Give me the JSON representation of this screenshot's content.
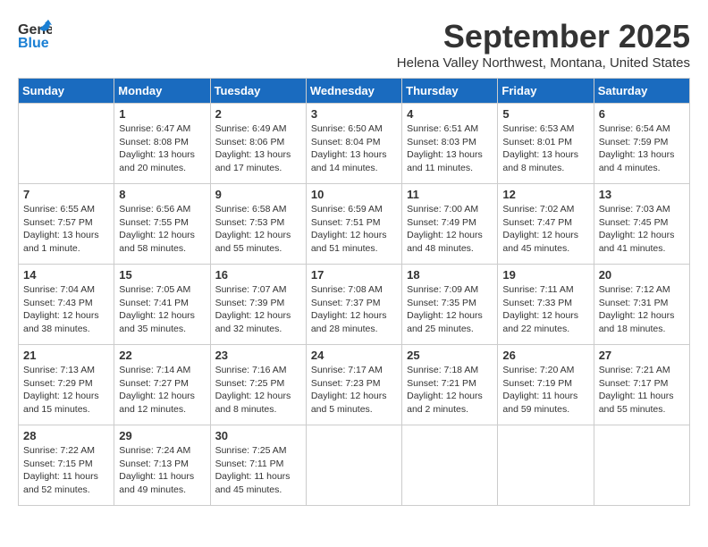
{
  "header": {
    "logo_general": "General",
    "logo_blue": "Blue",
    "title": "September 2025",
    "subtitle": "Helena Valley Northwest, Montana, United States"
  },
  "days_of_week": [
    "Sunday",
    "Monday",
    "Tuesday",
    "Wednesday",
    "Thursday",
    "Friday",
    "Saturday"
  ],
  "weeks": [
    [
      {
        "day": "",
        "content": ""
      },
      {
        "day": "1",
        "content": "Sunrise: 6:47 AM\nSunset: 8:08 PM\nDaylight: 13 hours\nand 20 minutes."
      },
      {
        "day": "2",
        "content": "Sunrise: 6:49 AM\nSunset: 8:06 PM\nDaylight: 13 hours\nand 17 minutes."
      },
      {
        "day": "3",
        "content": "Sunrise: 6:50 AM\nSunset: 8:04 PM\nDaylight: 13 hours\nand 14 minutes."
      },
      {
        "day": "4",
        "content": "Sunrise: 6:51 AM\nSunset: 8:03 PM\nDaylight: 13 hours\nand 11 minutes."
      },
      {
        "day": "5",
        "content": "Sunrise: 6:53 AM\nSunset: 8:01 PM\nDaylight: 13 hours\nand 8 minutes."
      },
      {
        "day": "6",
        "content": "Sunrise: 6:54 AM\nSunset: 7:59 PM\nDaylight: 13 hours\nand 4 minutes."
      }
    ],
    [
      {
        "day": "7",
        "content": "Sunrise: 6:55 AM\nSunset: 7:57 PM\nDaylight: 13 hours\nand 1 minute."
      },
      {
        "day": "8",
        "content": "Sunrise: 6:56 AM\nSunset: 7:55 PM\nDaylight: 12 hours\nand 58 minutes."
      },
      {
        "day": "9",
        "content": "Sunrise: 6:58 AM\nSunset: 7:53 PM\nDaylight: 12 hours\nand 55 minutes."
      },
      {
        "day": "10",
        "content": "Sunrise: 6:59 AM\nSunset: 7:51 PM\nDaylight: 12 hours\nand 51 minutes."
      },
      {
        "day": "11",
        "content": "Sunrise: 7:00 AM\nSunset: 7:49 PM\nDaylight: 12 hours\nand 48 minutes."
      },
      {
        "day": "12",
        "content": "Sunrise: 7:02 AM\nSunset: 7:47 PM\nDaylight: 12 hours\nand 45 minutes."
      },
      {
        "day": "13",
        "content": "Sunrise: 7:03 AM\nSunset: 7:45 PM\nDaylight: 12 hours\nand 41 minutes."
      }
    ],
    [
      {
        "day": "14",
        "content": "Sunrise: 7:04 AM\nSunset: 7:43 PM\nDaylight: 12 hours\nand 38 minutes."
      },
      {
        "day": "15",
        "content": "Sunrise: 7:05 AM\nSunset: 7:41 PM\nDaylight: 12 hours\nand 35 minutes."
      },
      {
        "day": "16",
        "content": "Sunrise: 7:07 AM\nSunset: 7:39 PM\nDaylight: 12 hours\nand 32 minutes."
      },
      {
        "day": "17",
        "content": "Sunrise: 7:08 AM\nSunset: 7:37 PM\nDaylight: 12 hours\nand 28 minutes."
      },
      {
        "day": "18",
        "content": "Sunrise: 7:09 AM\nSunset: 7:35 PM\nDaylight: 12 hours\nand 25 minutes."
      },
      {
        "day": "19",
        "content": "Sunrise: 7:11 AM\nSunset: 7:33 PM\nDaylight: 12 hours\nand 22 minutes."
      },
      {
        "day": "20",
        "content": "Sunrise: 7:12 AM\nSunset: 7:31 PM\nDaylight: 12 hours\nand 18 minutes."
      }
    ],
    [
      {
        "day": "21",
        "content": "Sunrise: 7:13 AM\nSunset: 7:29 PM\nDaylight: 12 hours\nand 15 minutes."
      },
      {
        "day": "22",
        "content": "Sunrise: 7:14 AM\nSunset: 7:27 PM\nDaylight: 12 hours\nand 12 minutes."
      },
      {
        "day": "23",
        "content": "Sunrise: 7:16 AM\nSunset: 7:25 PM\nDaylight: 12 hours\nand 8 minutes."
      },
      {
        "day": "24",
        "content": "Sunrise: 7:17 AM\nSunset: 7:23 PM\nDaylight: 12 hours\nand 5 minutes."
      },
      {
        "day": "25",
        "content": "Sunrise: 7:18 AM\nSunset: 7:21 PM\nDaylight: 12 hours\nand 2 minutes."
      },
      {
        "day": "26",
        "content": "Sunrise: 7:20 AM\nSunset: 7:19 PM\nDaylight: 11 hours\nand 59 minutes."
      },
      {
        "day": "27",
        "content": "Sunrise: 7:21 AM\nSunset: 7:17 PM\nDaylight: 11 hours\nand 55 minutes."
      }
    ],
    [
      {
        "day": "28",
        "content": "Sunrise: 7:22 AM\nSunset: 7:15 PM\nDaylight: 11 hours\nand 52 minutes."
      },
      {
        "day": "29",
        "content": "Sunrise: 7:24 AM\nSunset: 7:13 PM\nDaylight: 11 hours\nand 49 minutes."
      },
      {
        "day": "30",
        "content": "Sunrise: 7:25 AM\nSunset: 7:11 PM\nDaylight: 11 hours\nand 45 minutes."
      },
      {
        "day": "",
        "content": ""
      },
      {
        "day": "",
        "content": ""
      },
      {
        "day": "",
        "content": ""
      },
      {
        "day": "",
        "content": ""
      }
    ]
  ]
}
